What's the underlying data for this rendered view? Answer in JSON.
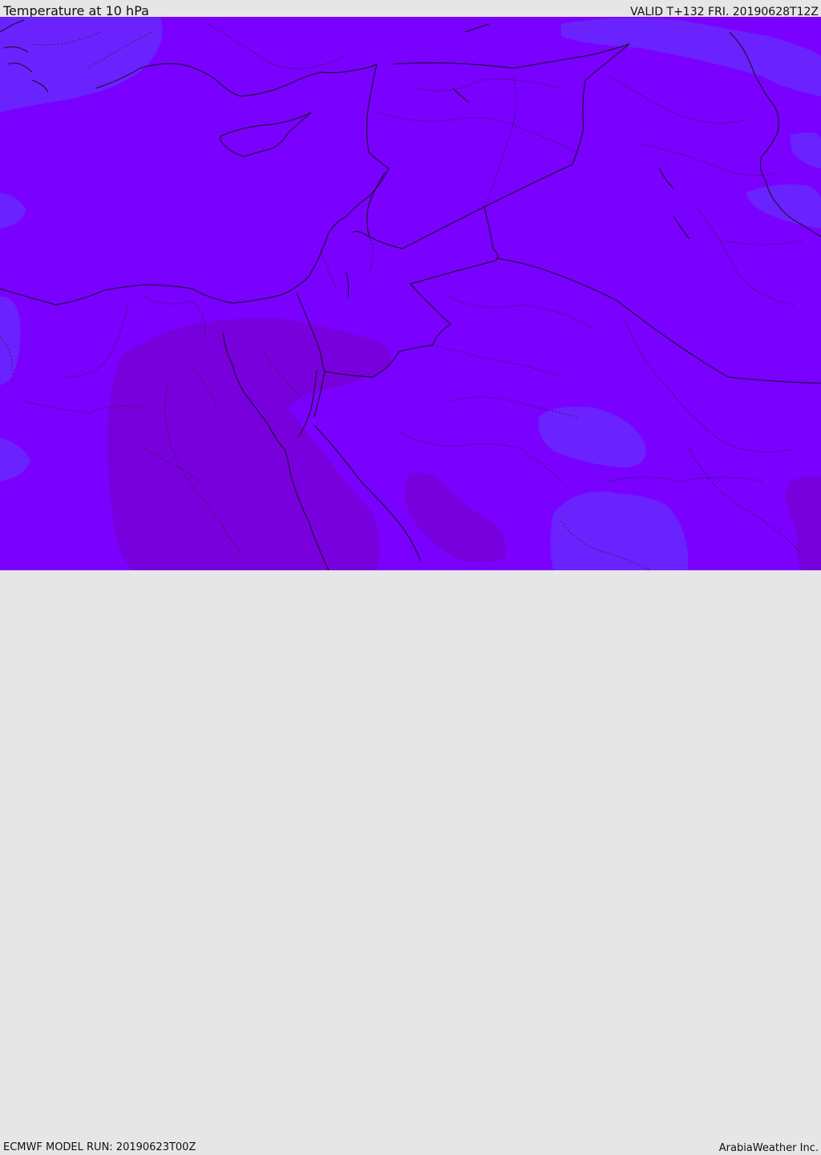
{
  "header": {
    "title": "Temperature at 10 hPa",
    "valid": "VALID T+132 FRI. 20190628T12Z"
  },
  "footer": {
    "model_run": "ECMWF MODEL RUN: 20190623T00Z",
    "credit": "ArabiaWeather Inc."
  },
  "map": {
    "colors": {
      "background_field": "#7a00ff",
      "cool_field": "#6a22ff",
      "warm_field": "#7a00dd",
      "coastline": "#111111",
      "border": "#222222"
    }
  }
}
